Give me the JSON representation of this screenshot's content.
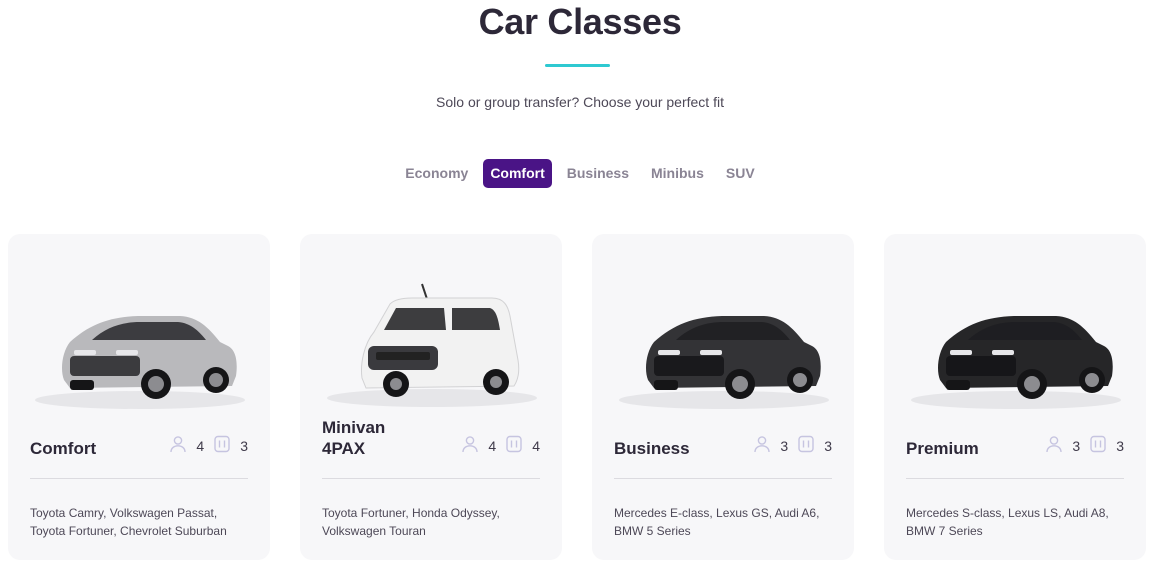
{
  "header": {
    "title": "Car Classes",
    "subtitle": "Solo or group transfer? Choose your perfect fit"
  },
  "tabs": [
    {
      "label": "Economy",
      "active": false
    },
    {
      "label": "Comfort",
      "active": true
    },
    {
      "label": "Business",
      "active": false
    },
    {
      "label": "Minibus",
      "active": false
    },
    {
      "label": "SUV",
      "active": false
    }
  ],
  "cards": [
    {
      "name": "Comfort",
      "passengers": "4",
      "luggage": "3",
      "models": "Toyota Camry, Volkswagen Passat, Toyota Fortuner, Chevrolet Suburban",
      "car_color": "#b9b9bc",
      "car_type": "sedan"
    },
    {
      "name": "Minivan 4PAX",
      "passengers": "4",
      "luggage": "4",
      "models": "Toyota Fortuner, Honda Odyssey, Volkswagen Touran",
      "car_color": "#f2f2f2",
      "car_type": "van"
    },
    {
      "name": "Business",
      "passengers": "3",
      "luggage": "3",
      "models": "Mercedes E-class, Lexus GS, Audi A6, BMW 5 Series",
      "car_color": "#333336",
      "car_type": "sedan"
    },
    {
      "name": "Premium",
      "passengers": "3",
      "luggage": "3",
      "models": "Mercedes S-class, Lexus LS, Audi A8, BMW 7 Series",
      "car_color": "#262628",
      "car_type": "sedan"
    }
  ],
  "colors": {
    "accent": "#4a1486",
    "underline": "#2ec9d1",
    "icon": "#c6c4e0"
  },
  "icons": {
    "passenger": "person-icon",
    "luggage": "luggage-icon"
  }
}
